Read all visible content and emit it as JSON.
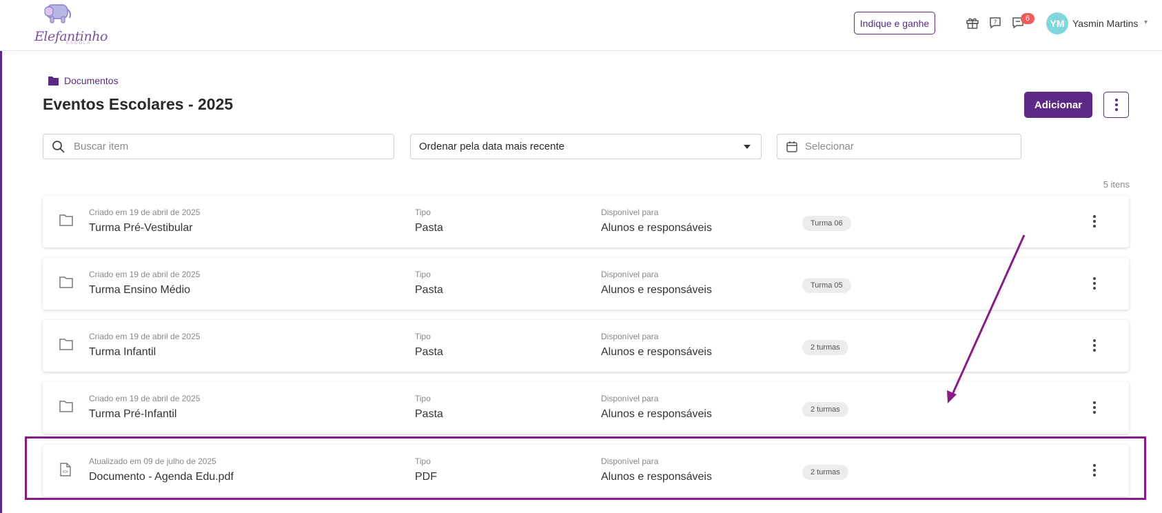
{
  "brand": {
    "name": "Elefantinho",
    "sub": "ESCOLA"
  },
  "header": {
    "invite_label": "Indique e ganhe",
    "icons": [
      "gift-icon",
      "help-icon",
      "chat-icon"
    ],
    "notification_count": "6",
    "user_initials": "YM",
    "user_name": "Yasmin Martins"
  },
  "breadcrumb": {
    "label": "Documentos"
  },
  "page": {
    "title": "Eventos Escolares - 2025",
    "add_label": "Adicionar"
  },
  "filters": {
    "search_placeholder": "Buscar item",
    "sort_value": "Ordenar pela data mais recente",
    "date_placeholder": "Selecionar"
  },
  "list": {
    "count_label": "5 itens",
    "type_label": "Tipo",
    "available_label": "Disponível para",
    "items": [
      {
        "meta": "Criado em 19 de abril de 2025",
        "name": "Turma Pré-Vestibular",
        "type": "Pasta",
        "available": "Alunos e responsáveis",
        "chip": "Turma 06",
        "icon": "folder-icon"
      },
      {
        "meta": "Criado em 19 de abril de 2025",
        "name": "Turma Ensino Médio",
        "type": "Pasta",
        "available": "Alunos e responsáveis",
        "chip": "Turma 05",
        "icon": "folder-icon"
      },
      {
        "meta": "Criado em 19 de abril de 2025",
        "name": "Turma Infantil",
        "type": "Pasta",
        "available": "Alunos e responsáveis",
        "chip": "2 turmas",
        "icon": "folder-icon"
      },
      {
        "meta": "Criado em 19 de abril de 2025",
        "name": "Turma Pré-Infantil",
        "type": "Pasta",
        "available": "Alunos e responsáveis",
        "chip": "2 turmas",
        "icon": "folder-icon"
      },
      {
        "meta": "Atualizado em 09 de julho de 2025",
        "name": "Documento - Agenda Edu.pdf",
        "type": "PDF",
        "available": "Alunos e responsáveis",
        "chip": "2 turmas",
        "icon": "pdf-file-icon"
      }
    ]
  },
  "colors": {
    "brand_purple": "#5b2a86",
    "annotation": "#8a1a8a",
    "badge": "#f05a5a",
    "avatar": "#7fd7dc"
  }
}
